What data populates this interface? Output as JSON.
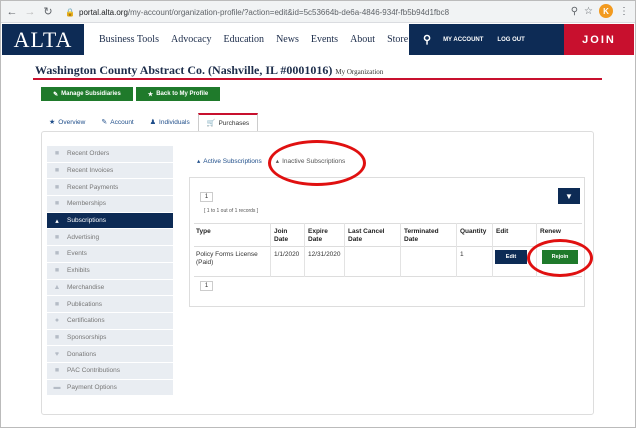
{
  "browser": {
    "url_host": "portal.alta.org",
    "url_path": "/my-account/organization-profile/?action=edit&id=5c53664b-de6a-4846-934f-fb5b94d1fbc8",
    "profile_initial": "K"
  },
  "header": {
    "logo": "ALTA",
    "nav": [
      "Business Tools",
      "Advocacy",
      "Education",
      "News",
      "Events",
      "About",
      "Store"
    ],
    "my_account": "MY ACCOUNT",
    "log_out": "LOG OUT",
    "join": "JOIN"
  },
  "page": {
    "title": "Washington County Abstract Co. (Nashville, IL #0001016)",
    "subtitle": "My Organization"
  },
  "actions": {
    "manage_subsidiaries": "Manage Subsidiaries",
    "back_to_profile": "Back to My Profile"
  },
  "tabs": [
    {
      "label": "Overview"
    },
    {
      "label": "Account"
    },
    {
      "label": "Individuals"
    },
    {
      "label": "Purchases"
    }
  ],
  "sidebar": {
    "items": [
      {
        "label": "Recent Orders"
      },
      {
        "label": "Recent Invoices"
      },
      {
        "label": "Recent Payments"
      },
      {
        "label": "Memberships"
      },
      {
        "label": "Subscriptions"
      },
      {
        "label": "Advertising"
      },
      {
        "label": "Events"
      },
      {
        "label": "Exhibits"
      },
      {
        "label": "Merchandise"
      },
      {
        "label": "Publications"
      },
      {
        "label": "Certifications"
      },
      {
        "label": "Sponsorships"
      },
      {
        "label": "Donations"
      },
      {
        "label": "PAC Contributions"
      },
      {
        "label": "Payment Options"
      }
    ]
  },
  "subtabs": {
    "active": "Active Subscriptions",
    "inactive": "Inactive Subscriptions"
  },
  "table": {
    "page_number": "1",
    "records": "[ 1 to 1 out of 1 records ]",
    "headers": {
      "type": "Type",
      "join_date": "Join Date",
      "expire_date": "Expire Date",
      "last_cancel_date": "Last Cancel Date",
      "terminated_date": "Terminated Date",
      "quantity": "Quantity",
      "edit": "Edit",
      "renew": "Renew"
    },
    "row": {
      "type": "Policy Forms License (Paid)",
      "join_date": "1/1/2020",
      "expire_date": "12/31/2020",
      "last_cancel_date": "",
      "terminated_date": "",
      "quantity": "1",
      "edit_label": "Edit",
      "renew_label": "Rejoin"
    }
  }
}
